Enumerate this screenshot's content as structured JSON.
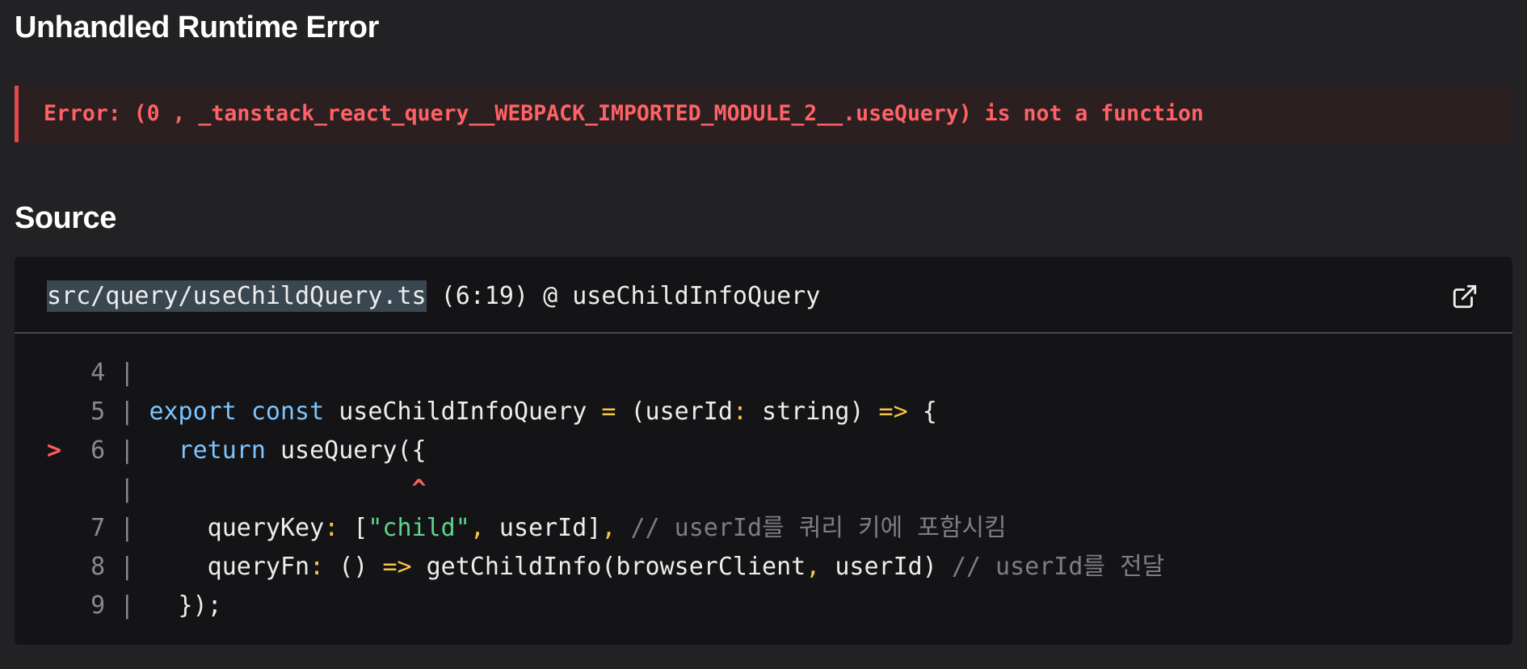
{
  "page": {
    "title": "Unhandled Runtime Error",
    "error_message": "Error: (0 , _tanstack_react_query__WEBPACK_IMPORTED_MODULE_2__.useQuery) is not a function",
    "source_title": "Source"
  },
  "source": {
    "file_path": "src/query/useChildQuery.ts",
    "location_suffix": " (6:19) @ useChildInfoQuery",
    "open_icon": "external-link-icon"
  },
  "colors": {
    "background": "#222225",
    "error_text": "#ff6166",
    "error_border": "#e5484d",
    "keyword": "#7cc4ff",
    "operator": "#f7c548",
    "string": "#5fd38d",
    "comment": "#7d7d82"
  },
  "code": {
    "l4": {
      "marker": "  ",
      "gutter": " 4 | "
    },
    "l5": {
      "marker": "  ",
      "gutter": " 5 | ",
      "t1": "export",
      "t2": " ",
      "t3": "const",
      "t4": " useChildInfoQuery ",
      "t5": "=",
      "t6": " (userId",
      "t7": ":",
      "t8": " string) ",
      "t9": "=>",
      "t10": " {"
    },
    "l6": {
      "marker": "> ",
      "gutter": " 6 | ",
      "t1": "  ",
      "t2": "return",
      "t3": " useQuery({"
    },
    "caret": {
      "marker": "  ",
      "gutter": "   | ",
      "pad": "                  ",
      "caret": "^"
    },
    "l7": {
      "marker": "  ",
      "gutter": " 7 | ",
      "t1": "    queryKey",
      "t2": ":",
      "t3": " [",
      "t4": "\"child\"",
      "t5": ",",
      "t6": " userId]",
      "t7": ",",
      "t8": " ",
      "t9": "// userId를 쿼리 키에 포함시킴"
    },
    "l8": {
      "marker": "  ",
      "gutter": " 8 | ",
      "t1": "    queryFn",
      "t2": ":",
      "t3": " () ",
      "t4": "=>",
      "t5": " getChildInfo(browserClient",
      "t6": ",",
      "t7": " userId) ",
      "t8": "// userId를 전달"
    },
    "l9": {
      "marker": "  ",
      "gutter": " 9 | ",
      "t1": "  });"
    }
  }
}
